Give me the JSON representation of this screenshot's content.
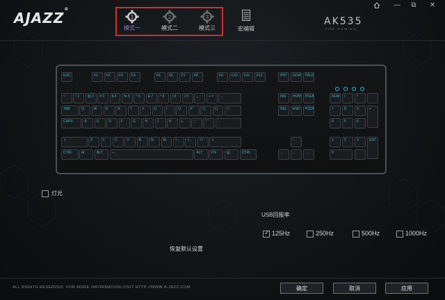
{
  "app": {
    "logo": "AJAZZ",
    "logo_mark": "®",
    "model": "AK535",
    "model_sub": "FOR GAMING"
  },
  "window_controls": {
    "home_icon": "home-icon",
    "minimize": "—",
    "restore": "⧉",
    "close": "✕"
  },
  "modes": [
    {
      "number": "1",
      "label": "模式一",
      "active": true
    },
    {
      "number": "2",
      "label": "模式二",
      "active": false
    },
    {
      "number": "3",
      "label": "模式三",
      "active": false
    }
  ],
  "macro": {
    "label": "宏编辑",
    "icon": "macro-editor-icon"
  },
  "keyboard": {
    "row_fn": [
      "ESC",
      "F1",
      "F2",
      "F3",
      "F4",
      "F5",
      "F6",
      "F7",
      "F8",
      "F9",
      "F10",
      "F11",
      "F12",
      "PRT",
      "SCROLL LOCK",
      "PAUSE"
    ],
    "row_num": [
      "~ `",
      "! 1",
      "@ 2",
      "# 3",
      "$ 4",
      "% 5",
      "^ 6",
      "& 7",
      "* 8",
      "( 9",
      ") 0",
      "_ -",
      "+ =",
      "←",
      "INS",
      "HOME",
      "PGUP",
      "NUM",
      "/",
      "*",
      "-"
    ],
    "row_q": [
      "TAB",
      "Q",
      "W",
      "E",
      "R",
      "T",
      "Y",
      "U",
      "I",
      "O",
      "P",
      "{ [",
      "} ]",
      "| \\",
      "DEL",
      "END",
      "PGDN",
      "7",
      "8",
      "9",
      "+"
    ],
    "row_a": [
      "CAPS",
      "A",
      "S",
      "D",
      "F",
      "G",
      "H",
      "J",
      "K",
      "L",
      ": ;",
      "\" '",
      "←",
      "4",
      "5",
      "6"
    ],
    "row_z": [
      "⇧",
      "Z",
      "X",
      "C",
      "V",
      "B",
      "N",
      "M",
      "< ,",
      "> .",
      "? /",
      "⇧",
      "↑",
      "1",
      "2",
      "3",
      "ENT"
    ],
    "row_ctrl": [
      "CTRL",
      "⊞",
      "ALT",
      "—",
      "ALT",
      "FN",
      "▤",
      "CTRL",
      "←",
      "↓",
      "→",
      "0",
      "."
    ]
  },
  "lighting": {
    "label": "灯光",
    "checked": false
  },
  "usb": {
    "label": "USB回报率",
    "rates": [
      {
        "label": "125Hz",
        "checked": true
      },
      {
        "label": "250Hz",
        "checked": false
      },
      {
        "label": "500Hz",
        "checked": false
      },
      {
        "label": "1000Hz",
        "checked": false
      }
    ]
  },
  "reset_label": "恢复默认设置",
  "footer": "ALL RIGHTS RESERVED. FOR MORE INFORMATION,VISIT HTTP://WWW.A-JAZZ.COM",
  "buttons": {
    "ok": "确定",
    "cancel": "取消",
    "apply": "应用"
  },
  "colors": {
    "accent_red": "#d0302b",
    "key_legend": "#3ab8d8",
    "active_mode": "#8f7bc9"
  }
}
